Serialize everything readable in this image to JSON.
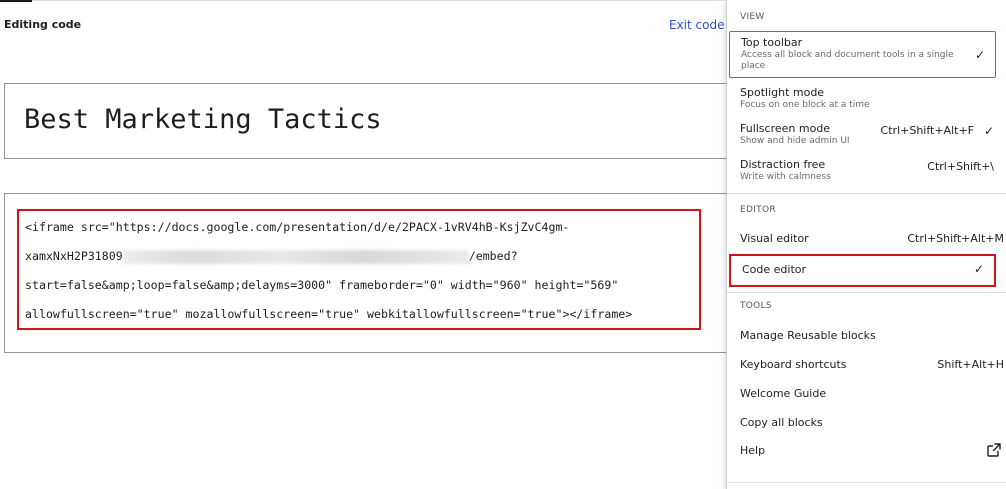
{
  "editor": {
    "mode_label": "Editing code",
    "exit_label": "Exit code editor",
    "post_title": "Best Marketing Tactics",
    "code_lines": [
      "<iframe src=\"https://docs.google.com/presentation/d/e/2PACX-1vRV4hB-KsjZvC4gm-",
      "xamxNxH2P31809",
      "/embed?",
      "start=false&amp;loop=false&amp;delayms=3000\" frameborder=\"0\" width=\"960\" height=\"569\"",
      "allowfullscreen=\"true\" mozallowfullscreen=\"true\" webkitallowfullscreen=\"true\"></iframe>"
    ]
  },
  "menu": {
    "view": {
      "title": "VIEW",
      "items": [
        {
          "label": "Top toolbar",
          "description": "Access all block and document tools in a single place",
          "shortcut": "",
          "check": "✓"
        },
        {
          "label": "Spotlight mode",
          "description": "Focus on one block at a time",
          "shortcut": "",
          "check": ""
        },
        {
          "label": "Fullscreen mode",
          "description": "Show and hide admin UI",
          "shortcut": "Ctrl+Shift+Alt+F",
          "check": "✓"
        },
        {
          "label": "Distraction free",
          "description": "Write with calmness",
          "shortcut": "Ctrl+Shift+\\",
          "check": ""
        }
      ]
    },
    "editor": {
      "title": "EDITOR",
      "items": [
        {
          "label": "Visual editor",
          "shortcut": "Ctrl+Shift+Alt+M"
        },
        {
          "label": "Code editor",
          "check": "✓"
        }
      ]
    },
    "tools": {
      "title": "TOOLS",
      "items": [
        {
          "label": "Manage Reusable blocks",
          "shortcut": ""
        },
        {
          "label": "Keyboard shortcuts",
          "shortcut": "Shift+Alt+H"
        },
        {
          "label": "Welcome Guide",
          "shortcut": ""
        },
        {
          "label": "Copy all blocks",
          "shortcut": ""
        },
        {
          "label": "Help",
          "icon": "external-link-icon"
        }
      ]
    }
  }
}
